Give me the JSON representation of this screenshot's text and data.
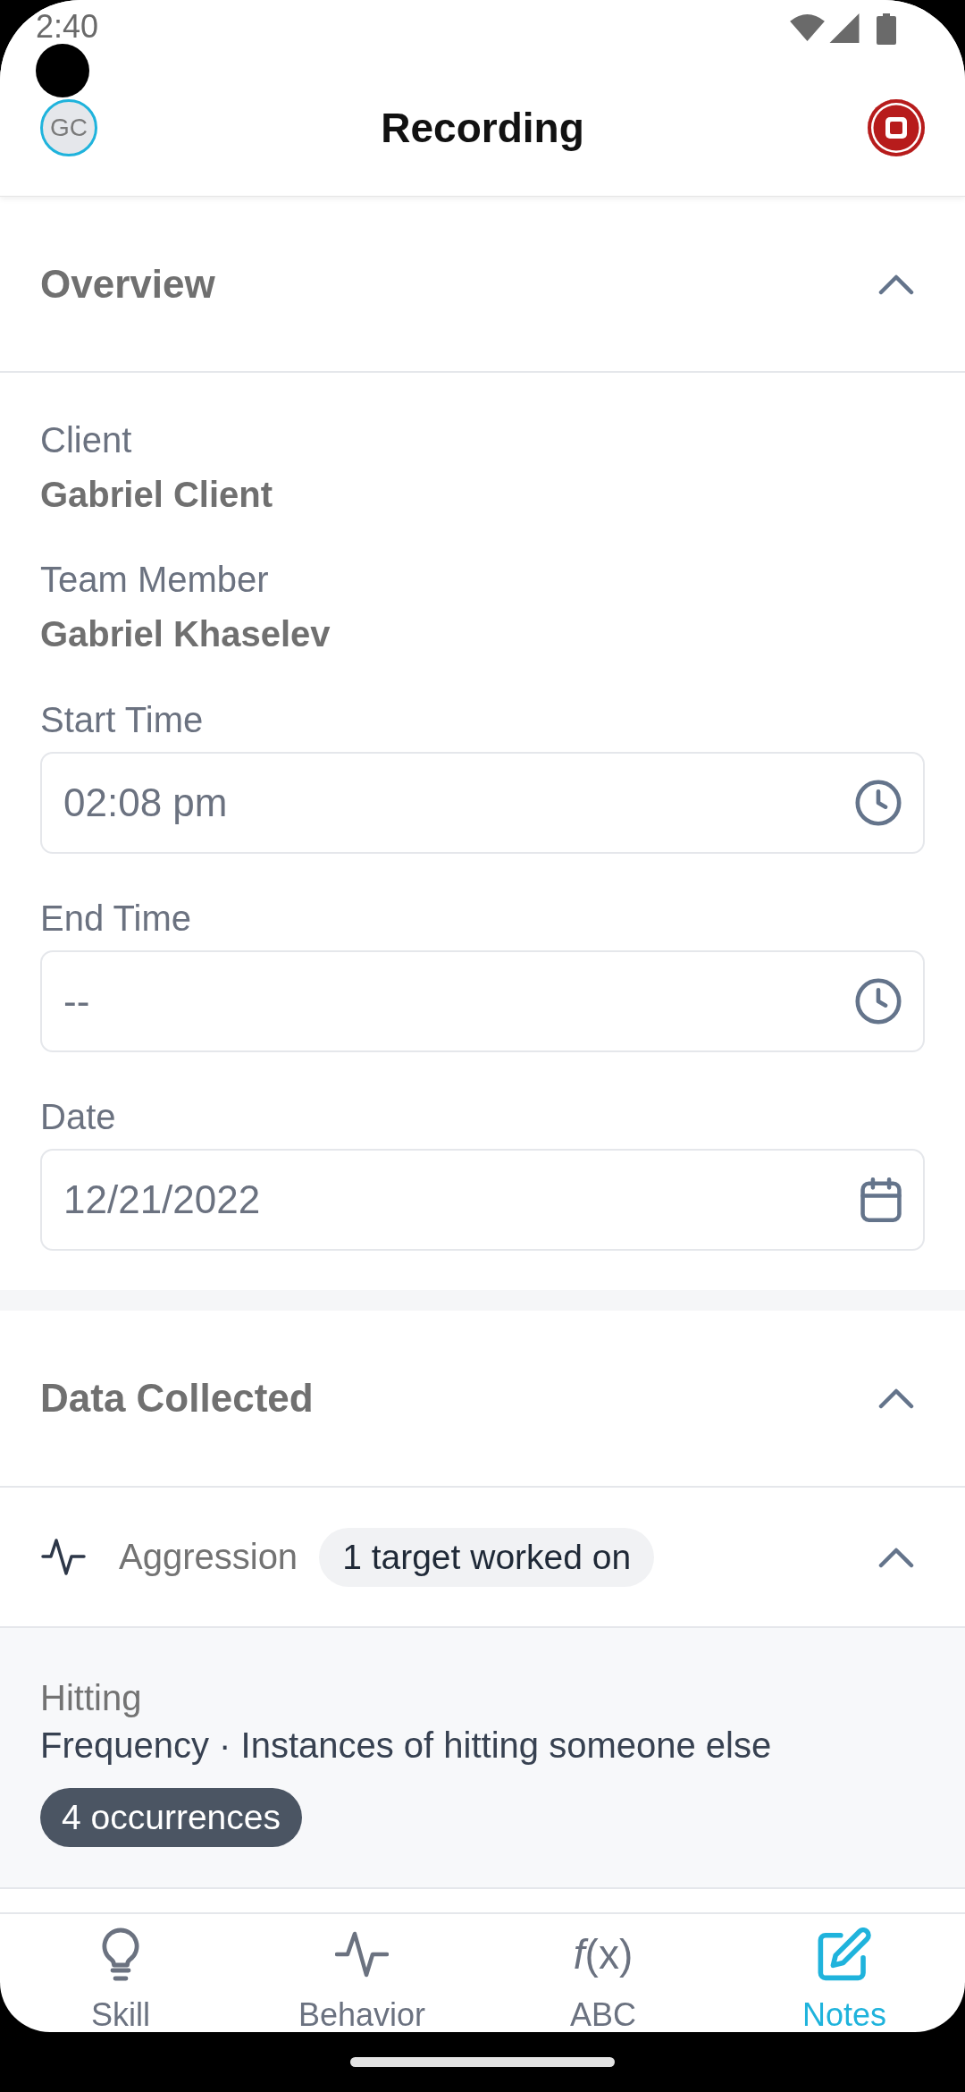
{
  "status_bar": {
    "time": "2:40"
  },
  "header": {
    "avatar_initials": "GC",
    "title": "Recording"
  },
  "overview": {
    "title": "Overview",
    "expanded": true,
    "info": [
      {
        "label": "Client",
        "value": "Gabriel Client"
      },
      {
        "label": "Team Member",
        "value": "Gabriel Khaselev"
      }
    ],
    "fields": [
      {
        "kind": "time",
        "label": "Start Time",
        "value": "02:08 pm"
      },
      {
        "kind": "time",
        "label": "End Time",
        "value": "--"
      },
      {
        "kind": "date",
        "label": "Date",
        "value": "12/21/2022"
      }
    ]
  },
  "data_collected": {
    "title": "Data Collected",
    "expanded": true,
    "behaviors": [
      {
        "name": "Aggression",
        "badge": "1 target worked on",
        "expanded": true,
        "targets": [
          {
            "name": "Hitting",
            "description": "Frequency · Instances of hitting someone else",
            "count": "4 occurrences"
          }
        ]
      }
    ]
  },
  "bottom_nav": [
    {
      "label": "Skill",
      "selected": false
    },
    {
      "label": "Behavior",
      "selected": false
    },
    {
      "label": "ABC",
      "glyph": "*f*(x)",
      "selected": false
    },
    {
      "label": "Notes",
      "selected": true
    }
  ]
}
